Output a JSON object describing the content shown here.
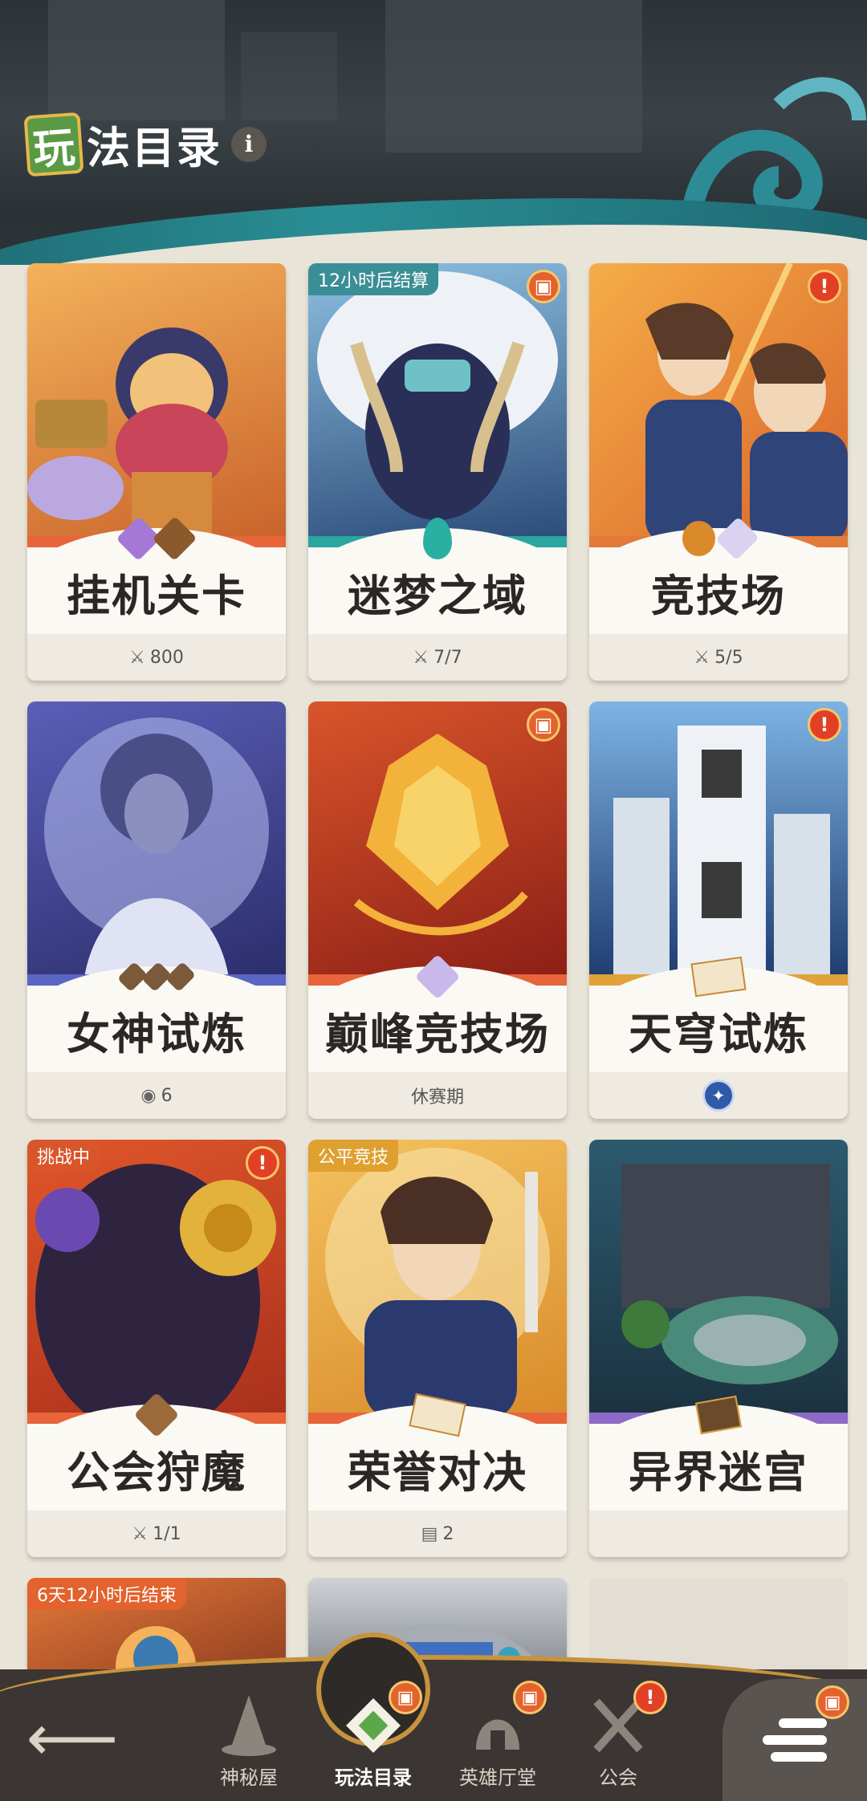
{
  "header": {
    "badge_char": "玩",
    "title": "法目录",
    "info_icon": "i"
  },
  "cards": [
    {
      "name": "挂机关卡",
      "footer": "800",
      "footer_icon": "crossed-swords-icon",
      "tag": "",
      "badge": "",
      "art_colors": [
        "#f3a34a",
        "#c8622b"
      ],
      "strip": "#e8643a"
    },
    {
      "name": "迷梦之域",
      "footer": "7/7",
      "footer_icon": "crossed-swords-icon",
      "tag": "12小时后结算",
      "badge": "gift",
      "art_colors": [
        "#7fb3d6",
        "#2b4a78"
      ],
      "strip": "#2aa6a0"
    },
    {
      "name": "竞技场",
      "footer": "5/5",
      "footer_icon": "crossed-swords-icon",
      "tag": "",
      "badge": "alert",
      "art_colors": [
        "#f3a03a",
        "#d9642a"
      ],
      "strip": "#e27a3a"
    },
    {
      "name": "女神试炼",
      "footer": "6",
      "footer_icon": "coin-icon",
      "tag": "",
      "badge": "",
      "art_colors": [
        "#7f88d8",
        "#3a3f8c"
      ],
      "strip": "#5a66c4"
    },
    {
      "name": "巅峰竞技场",
      "footer": "休赛期",
      "footer_icon": "",
      "tag": "",
      "badge": "gift",
      "art_colors": [
        "#d9552a",
        "#8b1e16"
      ],
      "strip": "#e8643a"
    },
    {
      "name": "天穹试炼",
      "footer": "",
      "footer_icon": "compass-icon",
      "tag": "",
      "badge": "alert",
      "art_colors": [
        "#6fa8de",
        "#1d3b6e"
      ],
      "strip": "#e1a23a"
    },
    {
      "name": "公会狩魔",
      "footer": "1/1",
      "footer_icon": "crossed-swords-icon",
      "tag": "挑战中",
      "badge": "alert",
      "art_colors": [
        "#e0562a",
        "#3a2450"
      ],
      "strip": "#e8643a"
    },
    {
      "name": "荣誉对决",
      "footer": "2",
      "footer_icon": "scroll-icon",
      "tag": "公平竞技",
      "badge": "",
      "art_colors": [
        "#f0b84e",
        "#2b3a6e"
      ],
      "strip": "#e8643a"
    },
    {
      "name": "异界迷宫",
      "footer": "",
      "footer_icon": "",
      "tag": "",
      "badge": "",
      "art_colors": [
        "#2c5a6e",
        "#1b3240"
      ],
      "strip": "#8e6ac8"
    },
    {
      "name": "",
      "footer": "",
      "footer_icon": "",
      "tag": "6天12小时后结束",
      "badge": "",
      "art_colors": [
        "#e47a3a",
        "#8a3a1e"
      ],
      "strip": ""
    },
    {
      "name": "",
      "footer": "",
      "footer_icon": "",
      "tag": "",
      "badge": "",
      "art_colors": [
        "#cfd2d6",
        "#7a8088"
      ],
      "strip": ""
    }
  ],
  "nav": {
    "back": "back-arrow-icon",
    "items": [
      {
        "label": "神秘屋",
        "icon": "witch-hat-icon",
        "badge": ""
      },
      {
        "label": "玩法目录",
        "icon": "catalog-diamond-icon",
        "badge": "gift"
      },
      {
        "label": "英雄厅堂",
        "icon": "helmet-icon",
        "badge": "gift"
      },
      {
        "label": "公会",
        "icon": "crossed-swords-icon",
        "badge": "alert"
      }
    ],
    "menu_badge": "gift"
  },
  "colors": {
    "gift_badge": "#e2632e",
    "alert_badge": "#e24025",
    "nav_bg": "#3b3633",
    "nav_rim": "#c7933d"
  }
}
